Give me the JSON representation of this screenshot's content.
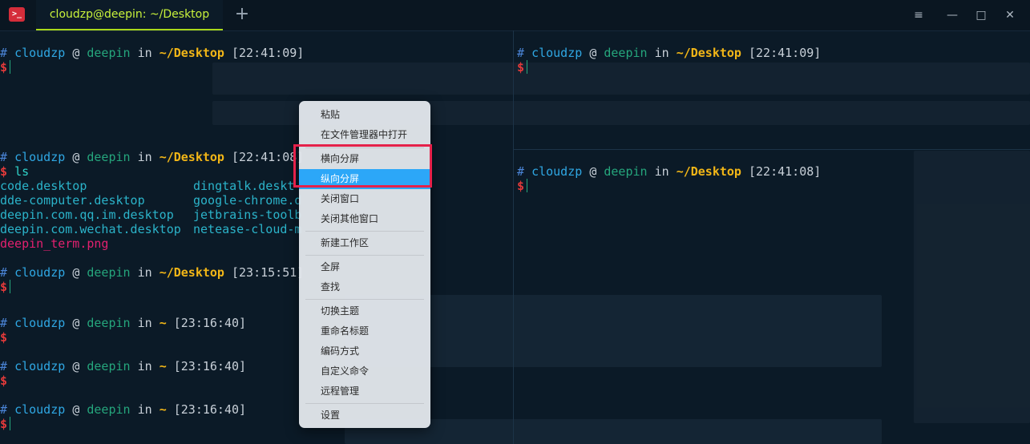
{
  "titlebar": {
    "tab_title": "cloudzp@deepin: ~/Desktop",
    "add_tab_label": "+",
    "menu_label": "≡",
    "minimize_label": "—",
    "maximize_label": "□",
    "close_label": "✕"
  },
  "prompt": {
    "hash": "#",
    "user": "cloudzp",
    "at": "@",
    "host": "deepin",
    "in": "in",
    "desktop_dir": "~/Desktop",
    "home_dir": "~",
    "dollar": "$"
  },
  "left_pane": {
    "block1_time": "[22:41:09]",
    "block2_time": "[22:41:08]",
    "block2_cmd": "ls",
    "ls_output": [
      {
        "col1": "code.desktop",
        "col2": "dingtalk.deskt"
      },
      {
        "col1": "dde-computer.desktop",
        "col2": "google-chrome.d"
      },
      {
        "col1": "deepin.com.qq.im.desktop",
        "col2": "jetbrains-toolb"
      },
      {
        "col1": "deepin.com.wechat.desktop",
        "col2": "netease-cloud-m"
      }
    ],
    "ls_png": "deepin_term.png",
    "block3_time": "[23:15:51]",
    "block4_time": "[23:16:40]",
    "block5_time": "[23:16:40]",
    "block6_time": "[23:16:40]"
  },
  "right_top_pane": {
    "time": "[22:41:09]"
  },
  "right_bottom_pane": {
    "time": "[22:41:08]"
  },
  "context_menu": {
    "items": [
      "粘贴",
      "在文件管理器中打开",
      "横向分屏",
      "纵向分屏",
      "关闭窗口",
      "关闭其他窗口",
      "新建工作区",
      "全屏",
      "查找",
      "切换主题",
      "重命名标题",
      "编码方式",
      "自定义命令",
      "远程管理",
      "设置"
    ],
    "active_item": "纵向分屏"
  },
  "colors": {
    "accent_tab": "#c9f23b",
    "menu_highlight": "#2ca7f8",
    "annotation_box": "#e5214a"
  }
}
